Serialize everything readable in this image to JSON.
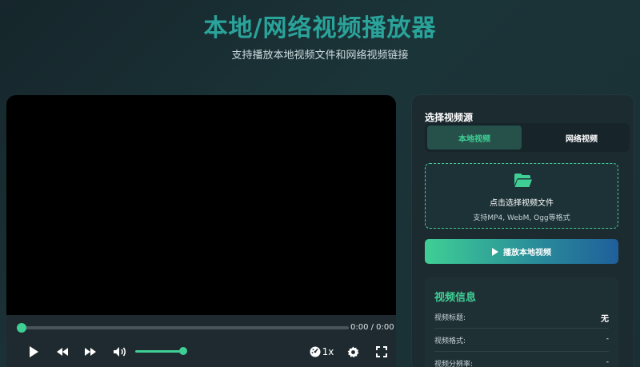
{
  "header": {
    "title": "本地/网络视频播放器",
    "subtitle": "支持播放本地视频文件和网络视频链接"
  },
  "player": {
    "time_display": "0:00 / 0:00",
    "progress": 0,
    "volume": 1.0,
    "speed_label": "1x",
    "icons": [
      "play-icon",
      "rewind-icon",
      "fast-forward-icon",
      "volume-icon",
      "speed-icon",
      "settings-icon",
      "fullscreen-icon"
    ]
  },
  "source_panel": {
    "title": "选择视频源",
    "tabs": [
      {
        "label": "本地视频",
        "active": true
      },
      {
        "label": "网络视频",
        "active": false
      }
    ],
    "dropzone": {
      "icon": "folder-open-icon",
      "text": "点击选择视频文件",
      "hint": "支持MP4, WebM, Ogg等格式"
    },
    "play_button_label": "播放本地视频"
  },
  "info": {
    "title": "视频信息",
    "rows": [
      {
        "key": "视频标题:",
        "value": "无"
      },
      {
        "key": "视频格式:",
        "value": "-"
      },
      {
        "key": "视频分辨率:",
        "value": "-"
      }
    ]
  },
  "colors": {
    "accent": "#3fcf95",
    "title": "#2aa39a",
    "panel": "#1c2b30"
  }
}
